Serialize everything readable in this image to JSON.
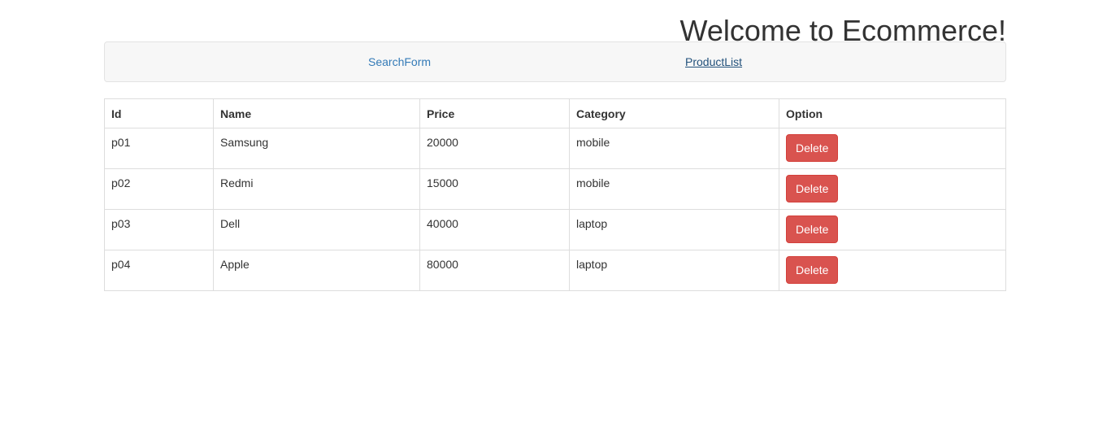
{
  "header": {
    "title": "Welcome to Ecommerce!"
  },
  "nav": {
    "items": [
      {
        "label": "SearchForm"
      },
      {
        "label": "ProductList"
      }
    ]
  },
  "table": {
    "headers": {
      "id": "Id",
      "name": "Name",
      "price": "Price",
      "category": "Category",
      "option": "Option"
    },
    "rows": [
      {
        "id": "p01",
        "name": "Samsung",
        "price": "20000",
        "category": "mobile",
        "action": "Delete"
      },
      {
        "id": "p02",
        "name": "Redmi",
        "price": "15000",
        "category": "mobile",
        "action": "Delete"
      },
      {
        "id": "p03",
        "name": "Dell",
        "price": "40000",
        "category": "laptop",
        "action": "Delete"
      },
      {
        "id": "p04",
        "name": "Apple",
        "price": "80000",
        "category": "laptop",
        "action": "Delete"
      }
    ]
  },
  "colors": {
    "link": "#337ab7",
    "danger": "#d9534f",
    "navbar_bg": "#f7f7f7"
  }
}
